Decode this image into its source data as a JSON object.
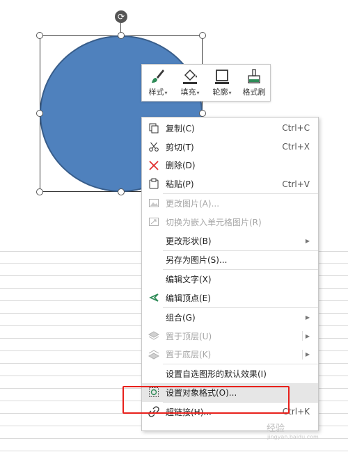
{
  "mini_toolbar": {
    "style_label": "样式",
    "fill_label": "填充",
    "outline_label": "轮廓",
    "format_painter_label": "格式刷"
  },
  "context_menu": {
    "copy": {
      "label": "复制(C)",
      "shortcut": "Ctrl+C"
    },
    "cut": {
      "label": "剪切(T)",
      "shortcut": "Ctrl+X"
    },
    "delete": {
      "label": "删除(D)"
    },
    "paste": {
      "label": "粘贴(P)",
      "shortcut": "Ctrl+V"
    },
    "change_picture": {
      "label": "更改图片(A)..."
    },
    "embed_cell_picture": {
      "label": "切换为嵌入单元格图片(R)"
    },
    "change_shape": {
      "label": "更改形状(B)"
    },
    "save_as_picture": {
      "label": "另存为图片(S)..."
    },
    "edit_text": {
      "label": "编辑文字(X)"
    },
    "edit_points": {
      "label": "编辑顶点(E)"
    },
    "group": {
      "label": "组合(G)"
    },
    "bring_to_front": {
      "label": "置于顶层(U)"
    },
    "send_to_back": {
      "label": "置于底层(K)"
    },
    "set_default_effect": {
      "label": "设置自选图形的默认效果(I)"
    },
    "format_object": {
      "label": "设置对象格式(O)..."
    },
    "hyperlink": {
      "label": "超链接(H)...",
      "shortcut": "Ctrl+K"
    }
  },
  "watermark": {
    "text": "经验",
    "sub": "jingyan.baidu.com"
  },
  "colors": {
    "shape_fill": "#4f81bd",
    "highlight_frame": "#e8201b"
  }
}
